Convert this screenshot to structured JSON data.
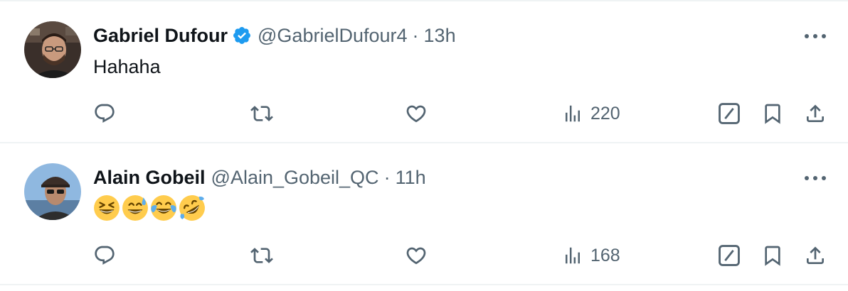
{
  "colors": {
    "text_primary": "#0f1419",
    "text_secondary": "#536471",
    "verified_blue": "#1d9bf0",
    "divider": "#eff3f4"
  },
  "tweets": [
    {
      "name": "Gabriel Dufour",
      "verified": true,
      "handle": "@GabrielDufour4",
      "separator": "·",
      "time": "13h",
      "text": "Hahaha",
      "views": "220",
      "avatar_icon": "avatar-photo"
    },
    {
      "name": "Alain Gobeil",
      "verified": false,
      "handle": "@Alain_Gobeil_QC",
      "separator": "·",
      "time": "11h",
      "emojis": [
        "grinning-squinting-face",
        "grinning-face-with-sweat",
        "face-with-tears-of-joy",
        "rolling-on-the-floor-laughing"
      ],
      "views": "168",
      "avatar_icon": "avatar-photo"
    }
  ],
  "icons": {
    "reply": "reply-icon",
    "retweet": "retweet-icon",
    "like": "like-icon",
    "views": "views-icon",
    "grok": "grok-icon",
    "bookmark": "bookmark-icon",
    "share": "share-icon",
    "more": "more-icon",
    "verified": "verified-badge-icon"
  }
}
